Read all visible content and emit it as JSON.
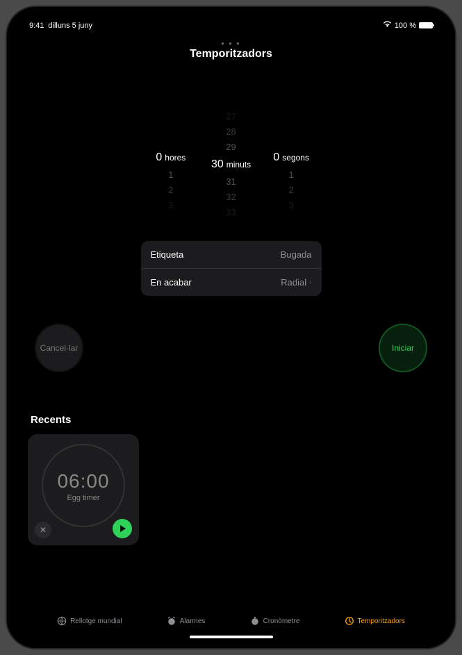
{
  "status": {
    "time": "9:41",
    "date": "dilluns 5 juny",
    "battery": "100 %"
  },
  "title": "Temporitzadors",
  "picker": {
    "hours": {
      "selected": "0",
      "label": "hores",
      "above": [
        "",
        "",
        ""
      ],
      "below": [
        "1",
        "2",
        "3"
      ]
    },
    "minutes": {
      "selected": "30",
      "label": "minuts",
      "above": [
        "27",
        "28",
        "29"
      ],
      "below": [
        "31",
        "32",
        "33"
      ]
    },
    "seconds": {
      "selected": "0",
      "label": "segons",
      "above": [
        "",
        "",
        ""
      ],
      "below": [
        "1",
        "2",
        "3"
      ]
    }
  },
  "settings": {
    "label_key": "Etiqueta",
    "label_value": "Bugada",
    "when_done_key": "En acabar",
    "when_done_value": "Radial"
  },
  "controls": {
    "cancel": "Cancel·lar",
    "start": "Iniciar"
  },
  "recents": {
    "title": "Recents",
    "items": [
      {
        "time": "06:00",
        "name": "Egg timer"
      }
    ]
  },
  "tabs": {
    "world": "Rellotge mundial",
    "alarm": "Alarmes",
    "stopwatch": "Cronòmetre",
    "timers": "Temporitzadors"
  }
}
